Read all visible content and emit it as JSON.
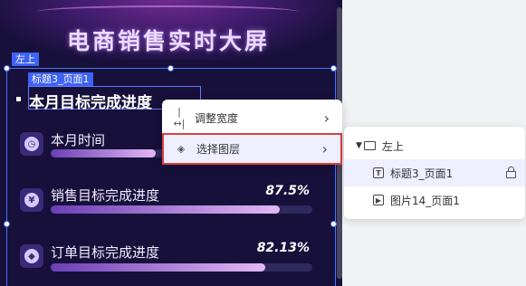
{
  "dashboard": {
    "title": "电商销售实时大屏",
    "section_title": "本月目标完成进度",
    "metrics": [
      {
        "icon": "clock-icon",
        "label": "本月时间",
        "value": "",
        "progress": 0.4
      },
      {
        "icon": "yen-icon",
        "label": "销售目标完成进度",
        "value": "87.5%",
        "progress": 0.875
      },
      {
        "icon": "tag-icon",
        "label": "订单目标完成进度",
        "value": "82.13%",
        "progress": 0.8213
      }
    ]
  },
  "selection": {
    "group_tag": "左上",
    "element_tag": "标题3_页面1"
  },
  "context_menu": {
    "items": [
      {
        "icon": "resize-width-icon",
        "label": "调整宽度"
      },
      {
        "icon": "layers-icon",
        "label": "选择图层"
      }
    ]
  },
  "layer_panel": {
    "folder": "左上",
    "layers": [
      {
        "type": "text",
        "label": "标题3_页面1",
        "locked": true
      },
      {
        "type": "image",
        "label": "图片14_页面1",
        "locked": false
      }
    ]
  },
  "colors": {
    "canvas_bg": "#17103a",
    "selection_blue": "#3e62f5",
    "highlight_red": "#e04040",
    "bar_gradient_start": "#6a3fb5",
    "bar_gradient_end": "#e3b8f5"
  }
}
